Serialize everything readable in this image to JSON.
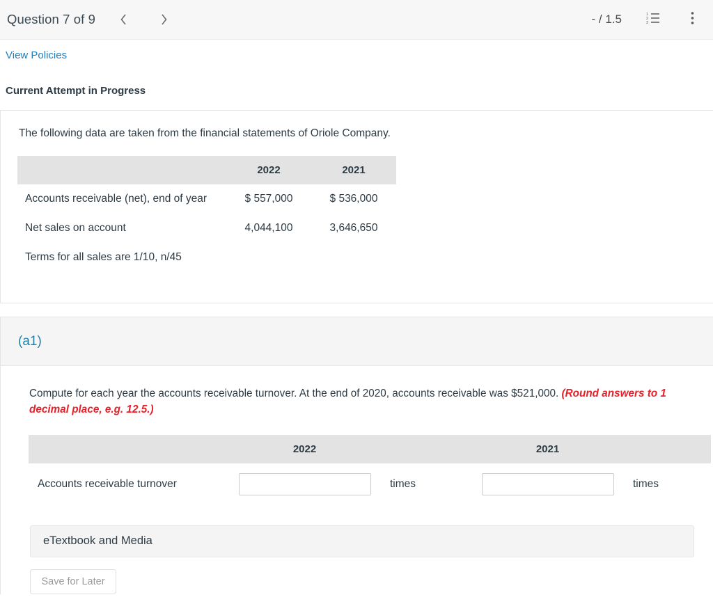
{
  "toolbar": {
    "question_title": "Question 7 of 9",
    "prev_icon": "chevron-left-icon",
    "next_icon": "chevron-right-icon",
    "score": "- / 1.5",
    "list_icon": "numbered-list-icon",
    "menu_icon": "vertical-dots-icon"
  },
  "page": {
    "view_policies": "View Policies",
    "attempt_status": "Current Attempt in Progress"
  },
  "data_card": {
    "intro": "The following data are taken from the financial statements of Oriole Company.",
    "table": {
      "headers": [
        "",
        "2022",
        "2021"
      ],
      "rows": [
        {
          "label": "Accounts receivable (net), end of year",
          "y2022": "$ 557,000",
          "y2021": "$ 536,000"
        },
        {
          "label": "Net sales on account",
          "y2022": "4,044,100",
          "y2021": "3,646,650"
        }
      ],
      "terms": "Terms for all sales are 1/10, n/45"
    }
  },
  "part": {
    "label": "(a1)",
    "prompt_main": "Compute for each year the accounts receivable turnover. At the end of 2020, accounts receivable was $521,000. ",
    "prompt_warning": "(Round answers to 1 decimal place, e.g. 12.5.)",
    "answer_table": {
      "headers": [
        "",
        "2022",
        "2021"
      ],
      "row_label": "Accounts receivable turnover",
      "value_2022": "",
      "value_2021": "",
      "placeholder_2022": "",
      "placeholder_2021": "",
      "unit_2022": "times",
      "unit_2021": "times"
    }
  },
  "footer": {
    "etextbook_label": "eTextbook and Media",
    "save_for_later": "Save for Later"
  },
  "colors": {
    "link": "#1f7fbf",
    "part_label": "#2181a6",
    "warning": "#e8202a",
    "table_header_bg": "#e3e3e3",
    "toolbar_bg": "#f7f7f7",
    "text": "#2d3b45"
  }
}
